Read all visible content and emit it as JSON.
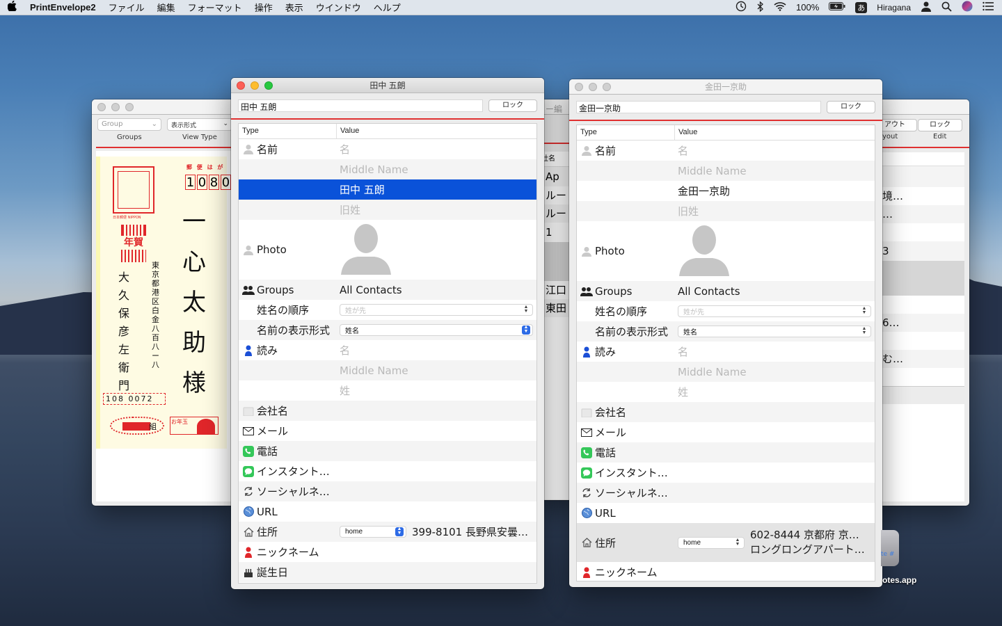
{
  "menubar": {
    "app_name": "PrintEnvelope2",
    "menus": [
      "ファイル",
      "編集",
      "フォーマット",
      "操作",
      "表示",
      "ウインドウ",
      "ヘルプ"
    ],
    "battery": "100%",
    "input_source": "Hiragana",
    "input_badge": "あ"
  },
  "left_window": {
    "group_select": "Group",
    "view_select": "表示形式",
    "groups_label": "Groups",
    "view_type_label": "View Type",
    "postal_header": "郵 便 は が",
    "postal_digits": [
      "1",
      "0",
      "8",
      "0"
    ],
    "stamp_caption": "日本郵便 NIPPON",
    "nenga": "年賀",
    "recipient": [
      "一",
      "心",
      "太",
      "助",
      "様"
    ],
    "sender_name": [
      "大",
      "久",
      "保",
      "彦",
      "左",
      "衛",
      "門"
    ],
    "sender_address": "東京都港区白金八百八ー八",
    "sender_zip": "108 0072",
    "lottery_label": "お年玉",
    "group_label": "組"
  },
  "back_right_window": {
    "layout_btn": "アウト",
    "lock_btn": "ロック",
    "layout_label": "yout",
    "edit_label": "Edit",
    "cells": [
      "境…",
      "…",
      "3",
      "6…",
      "む…"
    ]
  },
  "back_middle_window": {
    "title_fragment": "ー編",
    "column": "社名",
    "rows": [
      "Ap",
      "ルー",
      "ルー",
      "1",
      "江口",
      "東田"
    ]
  },
  "desktop_icon": {
    "label": "otes.app",
    "badge": "te #"
  },
  "table_headers": {
    "type": "Type",
    "value": "Value"
  },
  "win1": {
    "title": "田中 五朗",
    "name_field": "田中 五朗",
    "lock_button": "ロック",
    "rows": [
      {
        "type": "名前",
        "value": "名",
        "ph": true,
        "icon": "person-icon"
      },
      {
        "type": "",
        "value": "Middle Name",
        "ph": true
      },
      {
        "type": "",
        "value": "田中 五朗",
        "sel": true
      },
      {
        "type": "",
        "value": "旧姓",
        "ph": true
      },
      {
        "type": "Photo",
        "value": "",
        "icon": "person-icon"
      },
      {
        "type": "Groups",
        "value": "All Contacts",
        "icon": "groups-icon"
      },
      {
        "type": "姓名の順序",
        "value": "姓が先"
      },
      {
        "type": "名前の表示形式",
        "value": "姓名"
      },
      {
        "type": "読み",
        "value": "名",
        "ph": true,
        "icon": "reading-icon"
      },
      {
        "type": "",
        "value": "Middle Name",
        "ph": true
      },
      {
        "type": "",
        "value": "姓",
        "ph": true
      },
      {
        "type": "会社名",
        "value": "",
        "icon": "company-icon"
      },
      {
        "type": "メール",
        "value": "",
        "icon": "mail-icon"
      },
      {
        "type": "電話",
        "value": "",
        "icon": "phone-icon"
      },
      {
        "type": "インスタント…",
        "value": "",
        "icon": "messages-icon"
      },
      {
        "type": "ソーシャルネ…",
        "value": "",
        "icon": "social-icon"
      },
      {
        "type": "URL",
        "value": "",
        "icon": "globe-icon"
      },
      {
        "type": "住所",
        "value": "399-8101 長野県安曇…",
        "label": "home",
        "icon": "house-icon"
      },
      {
        "type": "ニックネーム",
        "value": "",
        "icon": "nickname-icon"
      },
      {
        "type": "誕生日",
        "value": "",
        "icon": "cake-icon"
      }
    ]
  },
  "win2": {
    "title": "金田一京助",
    "name_field": "金田一京助",
    "lock_button": "ロック",
    "rows": [
      {
        "type": "名前",
        "value": "名",
        "ph": true,
        "icon": "person-icon"
      },
      {
        "type": "",
        "value": "Middle Name",
        "ph": true
      },
      {
        "type": "",
        "value": "金田一京助"
      },
      {
        "type": "",
        "value": "旧姓",
        "ph": true
      },
      {
        "type": "Photo",
        "value": "",
        "icon": "person-icon"
      },
      {
        "type": "Groups",
        "value": "All Contacts",
        "icon": "groups-icon"
      },
      {
        "type": "姓名の順序",
        "value": "姓が先"
      },
      {
        "type": "名前の表示形式",
        "value": "姓名"
      },
      {
        "type": "読み",
        "value": "名",
        "ph": true,
        "icon": "reading-icon"
      },
      {
        "type": "",
        "value": "Middle Name",
        "ph": true
      },
      {
        "type": "",
        "value": "姓",
        "ph": true
      },
      {
        "type": "会社名",
        "value": "",
        "icon": "company-icon"
      },
      {
        "type": "メール",
        "value": "",
        "icon": "mail-icon"
      },
      {
        "type": "電話",
        "value": "",
        "icon": "phone-icon"
      },
      {
        "type": "インスタント…",
        "value": "",
        "icon": "messages-icon"
      },
      {
        "type": "ソーシャルネ…",
        "value": "",
        "icon": "social-icon"
      },
      {
        "type": "URL",
        "value": "",
        "icon": "globe-icon"
      },
      {
        "type": "住所",
        "value": "602-8444 京都府 京…",
        "value2": "ロングロングアパート…",
        "label": "home",
        "icon": "house-icon"
      },
      {
        "type": "ニックネーム",
        "value": "",
        "icon": "nickname-icon"
      }
    ]
  }
}
